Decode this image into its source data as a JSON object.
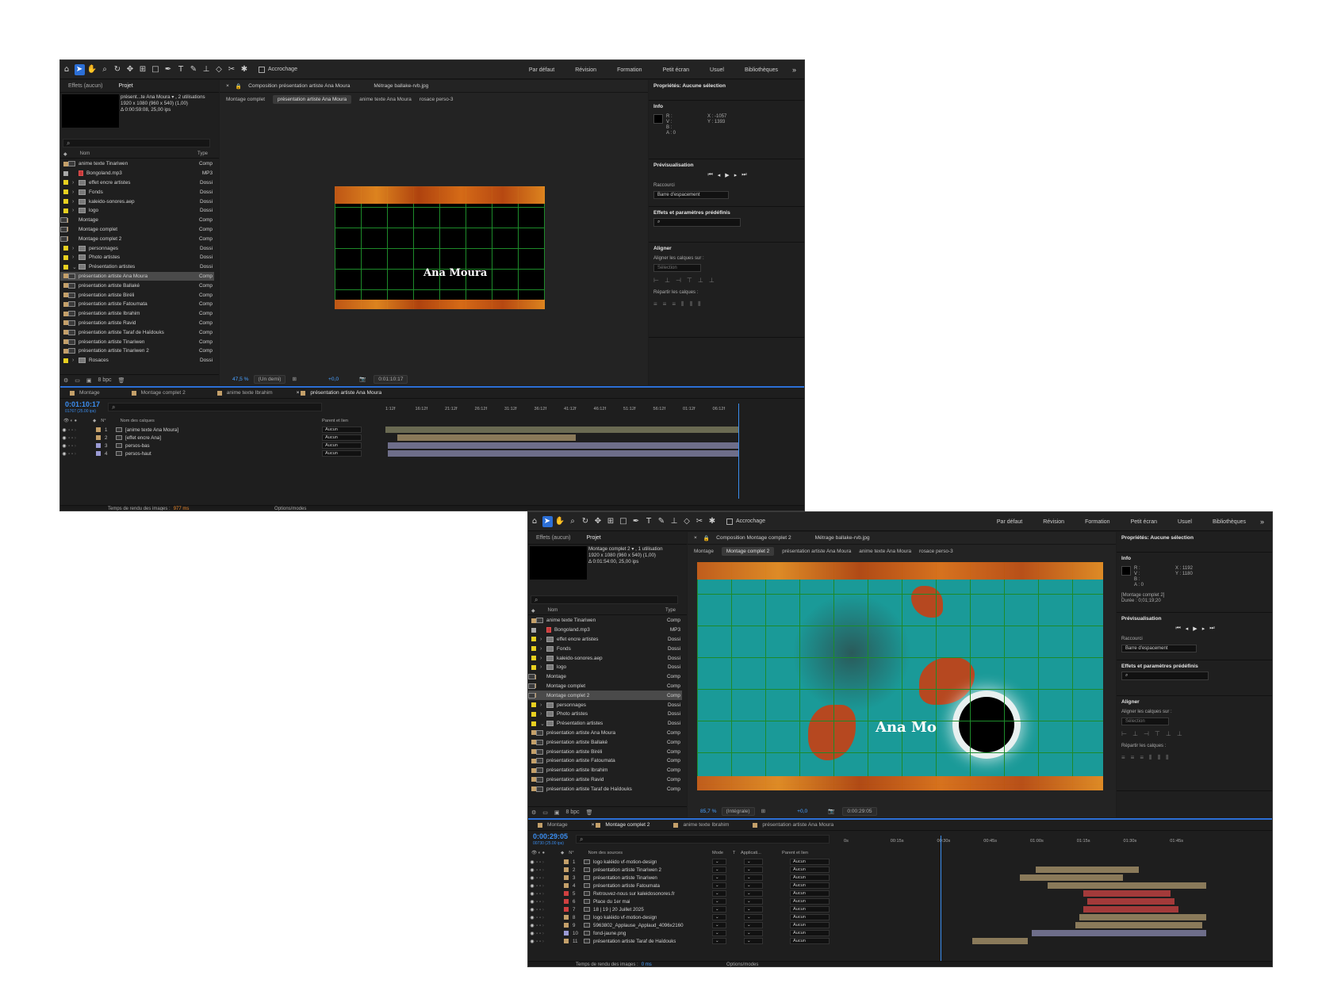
{
  "workspaces": [
    "Par défaut",
    "Révision",
    "Formation",
    "Petit écran",
    "Usuel",
    "Bibliothèques"
  ],
  "snap_label": "Accrochage",
  "w1": {
    "proj_tabs": [
      "Effets (aucun)",
      "Projet"
    ],
    "proj_info": [
      "présent...te Ana Moura ▾ , 2 utilisations",
      "1920 x 1080  (960 x 540) (1,00)",
      "Δ 0:00:59:08, 25,00 ips"
    ],
    "col_name": "Nom",
    "col_type": "Type",
    "items": [
      {
        "name": "anime texte Tinariwen",
        "type": "Comp",
        "k": "comp",
        "c": "#c4a06a",
        "i": 1,
        "t": ""
      },
      {
        "name": "Bongoland.mp3",
        "type": "MP3",
        "k": "audio",
        "c": "#a9a9a9",
        "i": 0,
        "t": ""
      },
      {
        "name": "effet encre artistes",
        "type": "Dossi",
        "k": "folder",
        "c": "#e8d020",
        "i": 0,
        "t": "›"
      },
      {
        "name": "Fonds",
        "type": "Dossi",
        "k": "folder",
        "c": "#e8d020",
        "i": 0,
        "t": "›"
      },
      {
        "name": "kaleido-sonores.aep",
        "type": "Dossi",
        "k": "folder",
        "c": "#e8d020",
        "i": 0,
        "t": "›"
      },
      {
        "name": "logo",
        "type": "Dossi",
        "k": "folder",
        "c": "#e8d020",
        "i": 0,
        "t": "›"
      },
      {
        "name": "Montage",
        "type": "Comp",
        "k": "comp",
        "c": "#c4a06a",
        "i": 0,
        "t": ""
      },
      {
        "name": "Montage complet",
        "type": "Comp",
        "k": "comp",
        "c": "#c4a06a",
        "i": 0,
        "t": ""
      },
      {
        "name": "Montage complet 2",
        "type": "Comp",
        "k": "comp",
        "c": "#c4a06a",
        "i": 0,
        "t": ""
      },
      {
        "name": "personnages",
        "type": "Dossi",
        "k": "folder",
        "c": "#e8d020",
        "i": 0,
        "t": "›"
      },
      {
        "name": "Photo artistes",
        "type": "Dossi",
        "k": "folder",
        "c": "#e8d020",
        "i": 0,
        "t": "›"
      },
      {
        "name": "Présentation artistes",
        "type": "Dossi",
        "k": "folder",
        "c": "#e8d020",
        "i": 0,
        "t": "⌄"
      },
      {
        "name": "présentation artiste Ana Moura",
        "type": "Comp",
        "k": "comp",
        "c": "#c4a06a",
        "i": 1,
        "t": "",
        "sel": true
      },
      {
        "name": "présentation artiste Ballaké",
        "type": "Comp",
        "k": "comp",
        "c": "#c4a06a",
        "i": 1,
        "t": ""
      },
      {
        "name": "présentation artiste Biréli",
        "type": "Comp",
        "k": "comp",
        "c": "#c4a06a",
        "i": 1,
        "t": ""
      },
      {
        "name": "présentation artiste Fatoumata",
        "type": "Comp",
        "k": "comp",
        "c": "#c4a06a",
        "i": 1,
        "t": ""
      },
      {
        "name": "présentation artiste Ibrahim",
        "type": "Comp",
        "k": "comp",
        "c": "#c4a06a",
        "i": 1,
        "t": ""
      },
      {
        "name": "présentation artiste Ravid",
        "type": "Comp",
        "k": "comp",
        "c": "#c4a06a",
        "i": 1,
        "t": ""
      },
      {
        "name": "présentation artiste Taraf de Haïdouks",
        "type": "Comp",
        "k": "comp",
        "c": "#c4a06a",
        "i": 1,
        "t": ""
      },
      {
        "name": "présentation artiste Tinariwen",
        "type": "Comp",
        "k": "comp",
        "c": "#c4a06a",
        "i": 1,
        "t": ""
      },
      {
        "name": "présentation artiste Tinariwen 2",
        "type": "Comp",
        "k": "comp",
        "c": "#c4a06a",
        "i": 1,
        "t": ""
      },
      {
        "name": "Rosaces",
        "type": "Dossi",
        "k": "folder",
        "c": "#e8d020",
        "i": 0,
        "t": "›"
      }
    ],
    "bpc": "8 bpc",
    "comp_tab": "Composition  présentation artiste Ana Moura",
    "footage_tab": "Métrage  ballake-rvb.jpg",
    "crumbs": [
      "Montage complet",
      "présentation artiste Ana Moura",
      "anime texte Ana Moura",
      "rosace perso-3"
    ],
    "viewer_text": "Ana Moura",
    "zoom": "47,5 %",
    "res": "(Un demi)",
    "exposure": "+0,0",
    "time": "0:01:10:17",
    "props": "Propriétés: Aucune sélection",
    "info_title": "Info",
    "info_xy": "X : -1057\nY : 1393",
    "preview": "Prévisualisation",
    "shortcut": "Raccourci",
    "shortcut_val": "Barre d'espacement",
    "effects": "Effets et paramètres prédéfinis",
    "align": "Aligner",
    "align_to": "Aligner les calques sur :",
    "selection": "Sélection",
    "distribute": "Répartir les calques :",
    "tl_tabs": [
      "Montage",
      "Montage complet 2",
      "anime texte Ibrahim",
      "présentation artiste Ana Moura"
    ],
    "tl_tab_colors": [
      "#c4a06a",
      "#c4a06a",
      "#c4a06a",
      "#c4a06a"
    ],
    "tl_time": "0:01:10:17",
    "tl_sub": "01767 (25.00 ips)",
    "tl_head": {
      "n": "N°",
      "name": "Nom des calques",
      "parent": "Parent et lien"
    },
    "layers": [
      {
        "n": "1",
        "name": "[anime texte Ana Moura]",
        "c": "#c4a06a",
        "par": "Aucun"
      },
      {
        "n": "2",
        "name": "[effet encre Ana]",
        "c": "#c4a06a",
        "par": "Aucun"
      },
      {
        "n": "3",
        "name": "persos-bas",
        "c": "#9a9ad4",
        "par": "Aucun"
      },
      {
        "n": "4",
        "name": "persos-haut",
        "c": "#9a9ad4",
        "par": "Aucun"
      }
    ],
    "ruler": [
      "1:12f",
      "16:12f",
      "21:12f",
      "26:12f",
      "31:12f",
      "36:12f",
      "41:12f",
      "46:12f",
      "51:12f",
      "56:12f",
      "01:12f",
      "06:12f"
    ],
    "render_label": "Temps de rendu des images :",
    "render_val": "977 ms",
    "options": "Options/modes"
  },
  "w2": {
    "proj_tabs": [
      "Effets (aucun)",
      "Projet"
    ],
    "proj_info": [
      "Montage complet 2 ▾ , 1 utilisation",
      "1920 x 1080  (960 x 540) (1,00)",
      "Δ 0:01:54:00, 25,00 ips"
    ],
    "col_name": "Nom",
    "col_type": "Type",
    "items": [
      {
        "name": "anime texte Tinariwen",
        "type": "Comp",
        "k": "comp",
        "c": "#c4a06a",
        "i": 1,
        "t": ""
      },
      {
        "name": "Bongoland.mp3",
        "type": "MP3",
        "k": "audio",
        "c": "#a9a9a9",
        "i": 0,
        "t": ""
      },
      {
        "name": "effet encre artistes",
        "type": "Dossi",
        "k": "folder",
        "c": "#e8d020",
        "i": 0,
        "t": "›"
      },
      {
        "name": "Fonds",
        "type": "Dossi",
        "k": "folder",
        "c": "#e8d020",
        "i": 0,
        "t": "›"
      },
      {
        "name": "kaleido-sonores.aep",
        "type": "Dossi",
        "k": "folder",
        "c": "#e8d020",
        "i": 0,
        "t": "›"
      },
      {
        "name": "logo",
        "type": "Dossi",
        "k": "folder",
        "c": "#e8d020",
        "i": 0,
        "t": "›"
      },
      {
        "name": "Montage",
        "type": "Comp",
        "k": "comp",
        "c": "#c4a06a",
        "i": 0,
        "t": ""
      },
      {
        "name": "Montage complet",
        "type": "Comp",
        "k": "comp",
        "c": "#c4a06a",
        "i": 0,
        "t": ""
      },
      {
        "name": "Montage complet 2",
        "type": "Comp",
        "k": "comp",
        "c": "#c4a06a",
        "i": 0,
        "t": "",
        "sel": true
      },
      {
        "name": "personnages",
        "type": "Dossi",
        "k": "folder",
        "c": "#e8d020",
        "i": 0,
        "t": "›"
      },
      {
        "name": "Photo artistes",
        "type": "Dossi",
        "k": "folder",
        "c": "#e8d020",
        "i": 0,
        "t": "›"
      },
      {
        "name": "Présentation artistes",
        "type": "Dossi",
        "k": "folder",
        "c": "#e8d020",
        "i": 0,
        "t": "⌄"
      },
      {
        "name": "présentation artiste Ana Moura",
        "type": "Comp",
        "k": "comp",
        "c": "#c4a06a",
        "i": 1,
        "t": ""
      },
      {
        "name": "présentation artiste Ballaké",
        "type": "Comp",
        "k": "comp",
        "c": "#c4a06a",
        "i": 1,
        "t": ""
      },
      {
        "name": "présentation artiste Biréli",
        "type": "Comp",
        "k": "comp",
        "c": "#c4a06a",
        "i": 1,
        "t": ""
      },
      {
        "name": "présentation artiste Fatoumata",
        "type": "Comp",
        "k": "comp",
        "c": "#c4a06a",
        "i": 1,
        "t": ""
      },
      {
        "name": "présentation artiste Ibrahim",
        "type": "Comp",
        "k": "comp",
        "c": "#c4a06a",
        "i": 1,
        "t": ""
      },
      {
        "name": "présentation artiste Ravid",
        "type": "Comp",
        "k": "comp",
        "c": "#c4a06a",
        "i": 1,
        "t": ""
      },
      {
        "name": "présentation artiste Taraf de Haïdouks",
        "type": "Comp",
        "k": "comp",
        "c": "#c4a06a",
        "i": 1,
        "t": ""
      }
    ],
    "bpc": "8 bpc",
    "comp_tab": "Composition  Montage complet 2",
    "footage_tab": "Métrage  ballake-rvb.jpg",
    "crumbs": [
      "Montage",
      "Montage complet 2",
      "présentation artiste Ana Moura",
      "anime texte Ana Moura",
      "rosace perso-3"
    ],
    "viewer_text": "Ana Mo",
    "zoom": "85,7 %",
    "res": "(Intégrale)",
    "exposure": "+0,0",
    "time": "0:00:29:05",
    "props": "Propriétés: Aucune sélection",
    "info_title": "Info",
    "info_xy": "X : 1192\nY : 1180",
    "info_comp": "[Montage complet 2]",
    "info_dur": "Durée : 0;01;19;20",
    "preview": "Prévisualisation",
    "shortcut": "Raccourci",
    "shortcut_val": "Barre d'espacement",
    "effects": "Effets et paramètres prédéfinis",
    "align": "Aligner",
    "align_to": "Aligner les calques sur :",
    "selection": "Sélection",
    "distribute": "Répartir les calques :",
    "tl_tabs": [
      "Montage",
      "Montage complet 2",
      "anime texte Ibrahim",
      "présentation artiste Ana Moura"
    ],
    "tl_time": "0:00:29:05",
    "tl_sub": "00730 (25.00 ips)",
    "tl_head": {
      "n": "N°",
      "name": "Nom des sources",
      "mode": "Mode",
      "t": "T",
      "app": "Applicati...",
      "parent": "Parent et lien"
    },
    "layers": [
      {
        "n": "1",
        "name": "logo kaléido vf-motion-design",
        "c": "#c4a06a",
        "par": "Aucun"
      },
      {
        "n": "2",
        "name": "présentation artiste Tinariwen 2",
        "c": "#c4a06a",
        "par": "Aucun"
      },
      {
        "n": "3",
        "name": "présentation artiste Tinariwen",
        "c": "#c4a06a",
        "par": "Aucun"
      },
      {
        "n": "4",
        "name": "présentation artiste Fatoumata",
        "c": "#c4a06a",
        "par": "Aucun"
      },
      {
        "n": "5",
        "name": "Retrouvez-nous sur kaleidosonores.fr",
        "c": "#d04040",
        "par": "Aucun"
      },
      {
        "n": "6",
        "name": "Place du 1er mai",
        "c": "#d04040",
        "par": "Aucun"
      },
      {
        "n": "7",
        "name": "18 | 19 | 20 Juillet 2025",
        "c": "#d04040",
        "par": "Aucun"
      },
      {
        "n": "8",
        "name": "logo kaléido vf-motion-design",
        "c": "#c4a06a",
        "par": "Aucun"
      },
      {
        "n": "9",
        "name": "5963802_Applause_Applaud_4096x2160",
        "c": "#c4a06a",
        "par": "Aucun"
      },
      {
        "n": "10",
        "name": "fond-jaune.png",
        "c": "#9a9ad4",
        "par": "Aucun"
      },
      {
        "n": "11",
        "name": "présentation artiste Taraf de Haïdouks",
        "c": "#c4a06a",
        "par": "Aucun"
      }
    ],
    "ruler": [
      "0s",
      "00:15s",
      "00:30s",
      "00:45s",
      "01:00s",
      "01:15s",
      "01:30s",
      "01:45s"
    ],
    "render_label": "Temps de rendu des images :",
    "render_val": "0 ms",
    "options": "Options/modes"
  }
}
